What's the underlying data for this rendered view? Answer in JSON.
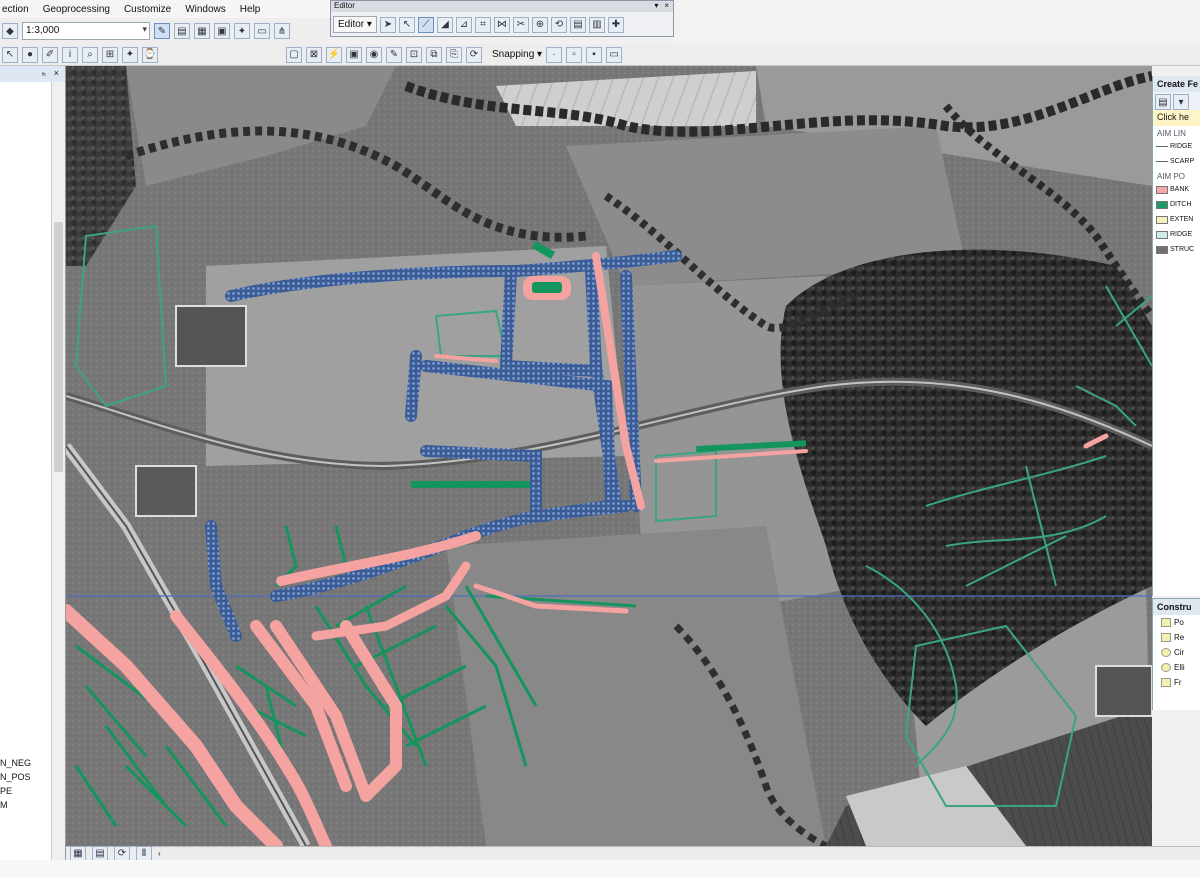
{
  "menu": {
    "items": [
      "ection",
      "Geoprocessing",
      "Customize",
      "Windows",
      "Help"
    ]
  },
  "toolbar": {
    "scale_value": "1:3,000"
  },
  "editor": {
    "title": "Editor",
    "dropdown_label": "Editor ▾"
  },
  "snapping": {
    "label": "Snapping ▾"
  },
  "toc": {
    "header_pin": "ₕ",
    "header_close": "×",
    "layers": [
      "",
      "N_NEG",
      "N_POS",
      "PE",
      "M",
      ""
    ]
  },
  "create_features": {
    "title": "Create Fe",
    "hint": "Click he",
    "group_lines": "AIM LIN",
    "group_polygons": "AIM PO",
    "line_items": [
      {
        "label": "RIDGE",
        "color": "#8ea0b8"
      },
      {
        "label": "SCARP",
        "color": "#6f7fa0"
      }
    ],
    "polygon_items": [
      {
        "label": "BANK",
        "color": "#f4a9a8"
      },
      {
        "label": "DITCH",
        "color": "#1e9966"
      },
      {
        "label": "EXTEN",
        "color": "#f6f0c0"
      },
      {
        "label": "RIDGE",
        "color": "#cfeee8"
      },
      {
        "label": "STRUC",
        "color": "#707070"
      }
    ]
  },
  "construction": {
    "title": "Constru",
    "items": [
      "Po",
      "Re",
      "Cir",
      "Elli",
      "Fr"
    ]
  },
  "colors": {
    "bank": "#f4a3a1",
    "ditch": "#14955e",
    "extent": "#3aa580",
    "mound": "#4a6ea8"
  }
}
